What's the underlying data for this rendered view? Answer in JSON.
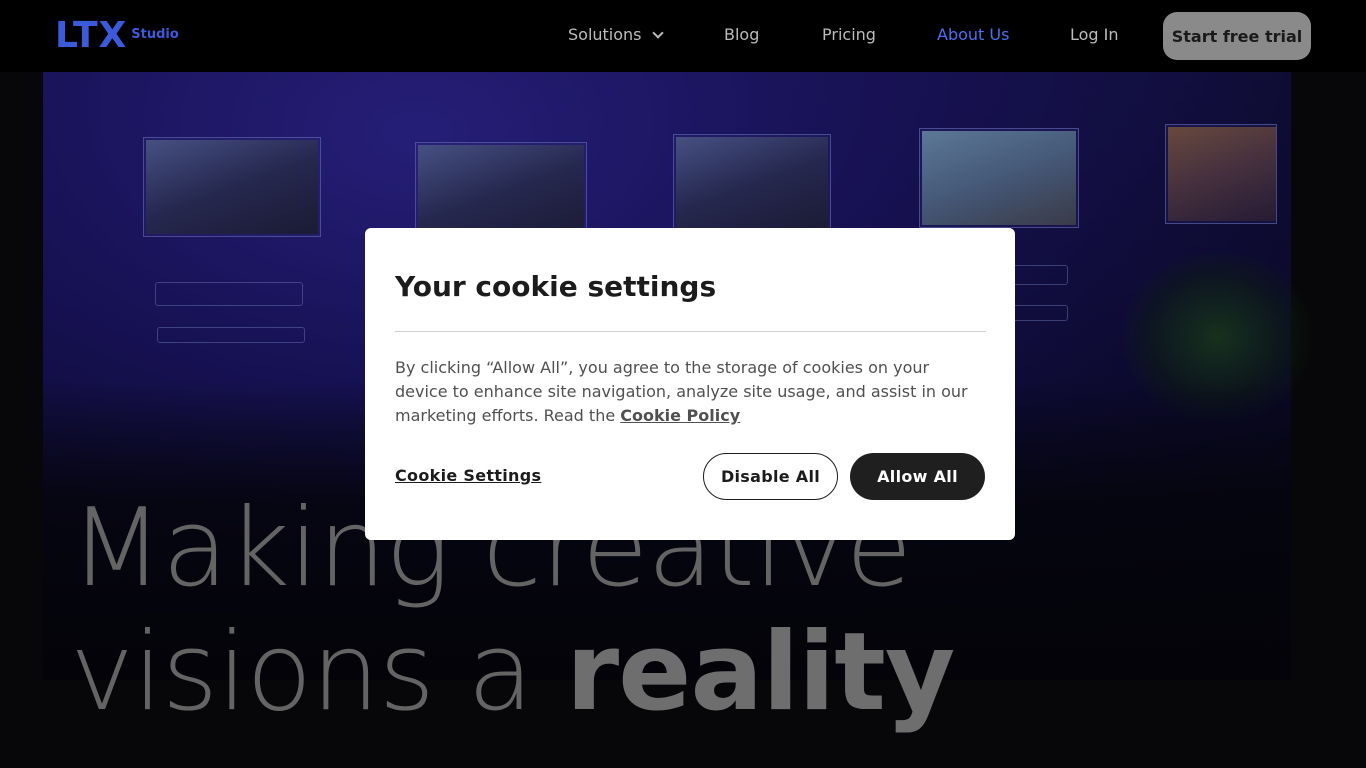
{
  "brand": {
    "logo": "LTX",
    "logo_sub": "Studio",
    "accent": "#3b5bdb"
  },
  "nav": {
    "solutions": "Solutions",
    "blog": "Blog",
    "pricing": "Pricing",
    "about": "About Us",
    "login": "Log In",
    "cta": "Start free trial"
  },
  "hero": {
    "line1": "Making creative",
    "line2_prefix": "visions a",
    "line2_strong": "reality"
  },
  "cookie": {
    "title": "Your cookie settings",
    "body": "By clicking “Allow All”, you agree to the storage of cookies on your device to enhance site navigation, analyze site usage, and assist in our marketing efforts. Read the",
    "policy_link": "Cookie Policy",
    "settings_link": "Cookie Settings",
    "disable_all": "Disable All",
    "allow_all": "Allow All"
  }
}
